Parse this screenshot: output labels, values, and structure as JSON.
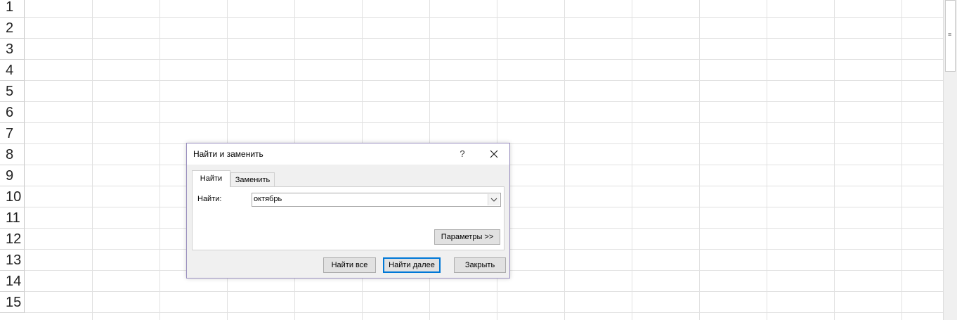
{
  "sheet": {
    "row_numbers": [
      "1",
      "2",
      "3",
      "4",
      "5",
      "6",
      "7",
      "8",
      "9",
      "10",
      "11",
      "12",
      "13",
      "14",
      "15"
    ]
  },
  "dialog": {
    "title": "Найти и заменить",
    "help_label": "?",
    "tabs": [
      {
        "label": "Найти",
        "active": true
      },
      {
        "label": "Заменить",
        "active": false
      }
    ],
    "find_label": "Найти:",
    "find_value": "октябрь",
    "params_button": "Параметры >>",
    "buttons": {
      "find_all": "Найти все",
      "find_next": "Найти далее",
      "close": "Закрыть"
    }
  },
  "colors": {
    "dialog_border": "#9a8fbf",
    "default_button_border": "#0078d7",
    "grid_line": "#e1e1e1"
  }
}
